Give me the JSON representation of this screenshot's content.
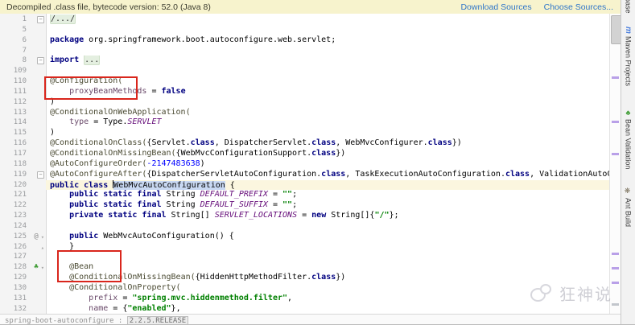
{
  "notification": {
    "message": "Decompiled .class file, bytecode version: 52.0 (Java 8)",
    "links": {
      "download": "Download Sources",
      "choose": "Choose Sources..."
    }
  },
  "right_stripe": {
    "tabs": [
      {
        "label": "base",
        "icon": ""
      },
      {
        "label": "Maven Projects",
        "icon": "m"
      },
      {
        "label": "Bean Validation",
        "icon": "bean"
      },
      {
        "label": "Ant Build",
        "icon": "ant"
      }
    ]
  },
  "bottom": {
    "prefix": "spring-boot-autoconfigure : ",
    "version": "2.2.5.RELEASE"
  },
  "watermark": {
    "text": "狂神说"
  },
  "colors": {
    "banner_bg": "#f7f3cd",
    "link_blue": "#2e75c9",
    "red_box": "#d9261c",
    "keyword": "#000080",
    "string": "#008000",
    "number": "#0000ff",
    "field_purple": "#660e7a",
    "selection": "#c8d8f2",
    "current_line": "#fbf6df",
    "bean_green": "#3f9c35",
    "maven_blue": "#4a7edd",
    "stripe_mark_purple": "#b9a0e8"
  },
  "editor": {
    "file_language": "Java decompiled class",
    "lines": [
      {
        "n": "1",
        "f": "-",
        "segs": [
          [
            "fold",
            "/.../"
          ]
        ]
      },
      {
        "n": "5",
        "segs": []
      },
      {
        "n": "6",
        "segs": [
          [
            "k",
            "package"
          ],
          [
            "p",
            " org.springframework.boot.autoconfigure.web.servlet;"
          ]
        ]
      },
      {
        "n": "7",
        "segs": []
      },
      {
        "n": "8",
        "f": "-",
        "segs": [
          [
            "k",
            "import"
          ],
          [
            "p",
            " "
          ],
          [
            "fold",
            "..."
          ]
        ]
      },
      {
        "n": "109",
        "segs": []
      },
      {
        "n": "110",
        "segs": [
          [
            "a",
            "@Configuration("
          ]
        ]
      },
      {
        "n": "111",
        "segs": [
          [
            "p",
            "    "
          ],
          [
            "at",
            "proxyBeanMethods"
          ],
          [
            "p",
            " = "
          ],
          [
            "k",
            "false"
          ]
        ]
      },
      {
        "n": "112",
        "segs": [
          [
            "p",
            ")"
          ]
        ]
      },
      {
        "n": "113",
        "segs": [
          [
            "a",
            "@ConditionalOnWebApplication("
          ]
        ]
      },
      {
        "n": "114",
        "segs": [
          [
            "p",
            "    "
          ],
          [
            "at",
            "type"
          ],
          [
            "p",
            " = Type."
          ],
          [
            "f",
            "SERVLET"
          ]
        ]
      },
      {
        "n": "115",
        "segs": [
          [
            "p",
            ")"
          ]
        ]
      },
      {
        "n": "116",
        "segs": [
          [
            "a",
            "@ConditionalOnClass("
          ],
          [
            "p",
            "{Servlet."
          ],
          [
            "k",
            "class"
          ],
          [
            "p",
            ", DispatcherServlet."
          ],
          [
            "k",
            "class"
          ],
          [
            "p",
            ", WebMvcConfigurer."
          ],
          [
            "k",
            "class"
          ],
          [
            "p",
            "})"
          ]
        ]
      },
      {
        "n": "117",
        "segs": [
          [
            "a",
            "@ConditionalOnMissingBean("
          ],
          [
            "p",
            "{WebMvcConfigurationSupport."
          ],
          [
            "k",
            "class"
          ],
          [
            "p",
            "})"
          ]
        ]
      },
      {
        "n": "118",
        "segs": [
          [
            "a",
            "@AutoConfigureOrder("
          ],
          [
            "n2",
            "-2147483638"
          ],
          [
            "p",
            ")"
          ]
        ]
      },
      {
        "n": "119",
        "f": "-",
        "segs": [
          [
            "a",
            "@AutoConfigureAfter("
          ],
          [
            "p",
            "{DispatcherServletAutoConfiguration."
          ],
          [
            "k",
            "class"
          ],
          [
            "p",
            ", TaskExecutionAutoConfiguration."
          ],
          [
            "k",
            "class"
          ],
          [
            "p",
            ", ValidationAutoCon"
          ]
        ]
      },
      {
        "n": "120",
        "cur": true,
        "segs": [
          [
            "k",
            "public class"
          ],
          [
            "p",
            " "
          ],
          [
            "caret",
            ""
          ],
          [
            "sel",
            "WebMvcAutoConfiguration"
          ],
          [
            "p",
            " {"
          ]
        ]
      },
      {
        "n": "121",
        "segs": [
          [
            "p",
            "    "
          ],
          [
            "k",
            "public static final"
          ],
          [
            "p",
            " String "
          ],
          [
            "f",
            "DEFAULT_PREFIX"
          ],
          [
            "p",
            " = "
          ],
          [
            "s",
            "\"\""
          ],
          [
            "p",
            ";"
          ]
        ]
      },
      {
        "n": "122",
        "segs": [
          [
            "p",
            "    "
          ],
          [
            "k",
            "public static final"
          ],
          [
            "p",
            " String "
          ],
          [
            "f",
            "DEFAULT_SUFFIX"
          ],
          [
            "p",
            " = "
          ],
          [
            "s",
            "\"\""
          ],
          [
            "p",
            ";"
          ]
        ]
      },
      {
        "n": "123",
        "segs": [
          [
            "p",
            "    "
          ],
          [
            "k",
            "private static final"
          ],
          [
            "p",
            " String[] "
          ],
          [
            "f",
            "SERVLET_LOCATIONS"
          ],
          [
            "p",
            " = "
          ],
          [
            "k",
            "new"
          ],
          [
            "p",
            " String[]{"
          ],
          [
            "s",
            "\"/\""
          ],
          [
            "p",
            "};"
          ]
        ]
      },
      {
        "n": "124",
        "segs": []
      },
      {
        "n": "125",
        "g": "at",
        "f": "o",
        "segs": [
          [
            "p",
            "    "
          ],
          [
            "k",
            "public"
          ],
          [
            "p",
            " WebMvcAutoConfiguration() {"
          ]
        ]
      },
      {
        "n": "126",
        "f": "c",
        "segs": [
          [
            "p",
            "    }"
          ]
        ]
      },
      {
        "n": "127",
        "segs": []
      },
      {
        "n": "128",
        "g": "bean",
        "f": "o",
        "segs": [
          [
            "p",
            "    "
          ],
          [
            "a",
            "@Bean"
          ]
        ]
      },
      {
        "n": "129",
        "segs": [
          [
            "p",
            "    "
          ],
          [
            "a",
            "@ConditionalOnMissingBean("
          ],
          [
            "p",
            "{HiddenHttpMethodFilter."
          ],
          [
            "k",
            "class"
          ],
          [
            "p",
            "})"
          ]
        ]
      },
      {
        "n": "130",
        "segs": [
          [
            "p",
            "    "
          ],
          [
            "a",
            "@ConditionalOnProperty("
          ]
        ]
      },
      {
        "n": "131",
        "segs": [
          [
            "p",
            "        "
          ],
          [
            "at",
            "prefix"
          ],
          [
            "p",
            " = "
          ],
          [
            "s",
            "\"spring.mvc.hiddenmethod.filter\""
          ],
          [
            "p",
            ","
          ]
        ]
      },
      {
        "n": "132",
        "segs": [
          [
            "p",
            "        "
          ],
          [
            "at",
            "name"
          ],
          [
            "p",
            " = {"
          ],
          [
            "s",
            "\"enabled\""
          ],
          [
            "p",
            "},"
          ]
        ]
      }
    ]
  }
}
